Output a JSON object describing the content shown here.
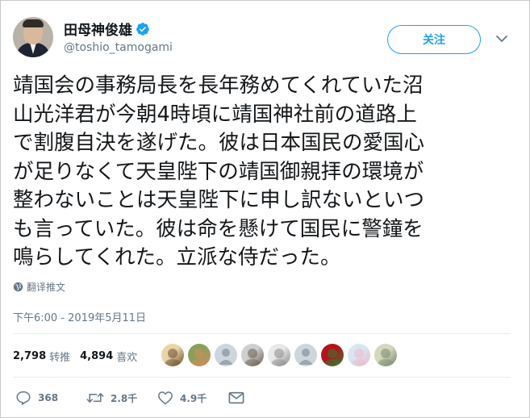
{
  "user": {
    "display_name": "田母神俊雄",
    "handle": "@toshio_tamogami",
    "verified_icon": "verified-badge-icon"
  },
  "follow_button": {
    "label": "关注"
  },
  "tweet": {
    "lines": [
      "靖国会の事務局長を長年務めてくれていた沼",
      "山光洋君が今朝4時頃に靖国神社前の道路上",
      "で割腹自決を遂げた。彼は日本国民の愛国心",
      "が足りなくて天皇陛下の靖国御親拝の環境が",
      "整わないことは天皇陛下に申し訳ないといつ",
      "も言っていた。彼は命を懸けて国民に警鐘を",
      "鳴らしてくれた。立派な侍だった。"
    ],
    "translate_label": "翻译推文",
    "timestamp": "下午6:00 - 2019年5月11日"
  },
  "stats": {
    "retweets_count": "2,798",
    "retweets_label": "转推",
    "likes_count": "4,894",
    "likes_label": "喜欢"
  },
  "likers": [
    {
      "kind": "photo",
      "colors": [
        "#e9d4a8",
        "#6b4a2b"
      ]
    },
    {
      "kind": "photo",
      "colors": [
        "#8aa05a",
        "#d98a5a"
      ]
    },
    {
      "kind": "default",
      "colors": [
        "#ccd6dd",
        "#9aa7b2"
      ]
    },
    {
      "kind": "photo",
      "colors": [
        "#cfcfcf",
        "#6b5b4a"
      ]
    },
    {
      "kind": "photo",
      "colors": [
        "#e8e8e8",
        "#8a8a8a"
      ]
    },
    {
      "kind": "default",
      "colors": [
        "#ccd6dd",
        "#9aa7b2"
      ]
    },
    {
      "kind": "photo",
      "colors": [
        "#b5121b",
        "#2e7d32"
      ]
    },
    {
      "kind": "photo",
      "colors": [
        "#d7e6f2",
        "#f0b8c8"
      ]
    },
    {
      "kind": "photo",
      "colors": [
        "#d4d8c0",
        "#7a8a6a"
      ]
    }
  ],
  "actions": {
    "reply_count": "368",
    "retweet_count": "2.8千",
    "like_count": "4.9千",
    "message_icon": "envelope-icon"
  },
  "colors": {
    "accent": "#1da1f2",
    "secondary_text": "#657786",
    "divider": "#e6ecf0"
  }
}
